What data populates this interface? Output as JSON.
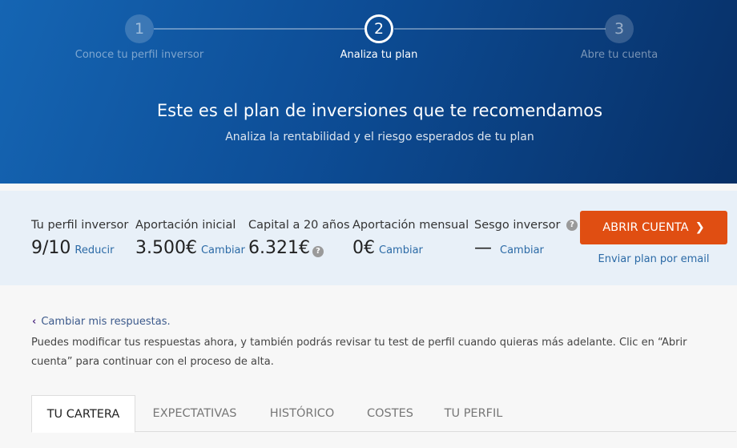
{
  "steps": [
    {
      "number": "1",
      "label": "Conoce tu perfil inversor"
    },
    {
      "number": "2",
      "label": "Analiza tu plan"
    },
    {
      "number": "3",
      "label": "Abre tu cuenta"
    }
  ],
  "hero": {
    "title": "Este es el plan de inversiones que te recomendamos",
    "subtitle": "Analiza la rentabilidad y el riesgo esperados de tu plan"
  },
  "summary": {
    "perfil": {
      "label": "Tu perfil inversor",
      "value": "9/10",
      "link": "Reducir"
    },
    "aportacion_inicial": {
      "label": "Aportación inicial",
      "value": "3.500€",
      "link": "Cambiar"
    },
    "capital": {
      "label": "Capital a 20 años",
      "value": "6.321€"
    },
    "aportacion_mensual": {
      "label": "Aportación mensual",
      "value": "0€",
      "link": "Cambiar"
    },
    "sesgo": {
      "label": "Sesgo inversor",
      "value": "—",
      "link": "Cambiar"
    },
    "cta_label": "ABRIR CUENTA",
    "email_link": "Enviar plan por email"
  },
  "back_link": "Cambiar mis respuestas.",
  "note": "Puedes modificar tus respuestas ahora, y también podrás revisar tu test de perfil cuando quieras más adelante. Clic en “Abrir cuenta” para continuar con el proceso de alta.",
  "tabs": [
    "TU CARTERA",
    "EXPECTATIVAS",
    "HISTÓRICO",
    "COSTES",
    "TU PERFIL"
  ],
  "colors": {
    "accent": "#e04e12",
    "link": "#2b6aa6",
    "hero_dark": "#072f66",
    "hero_light": "#1565b3"
  }
}
